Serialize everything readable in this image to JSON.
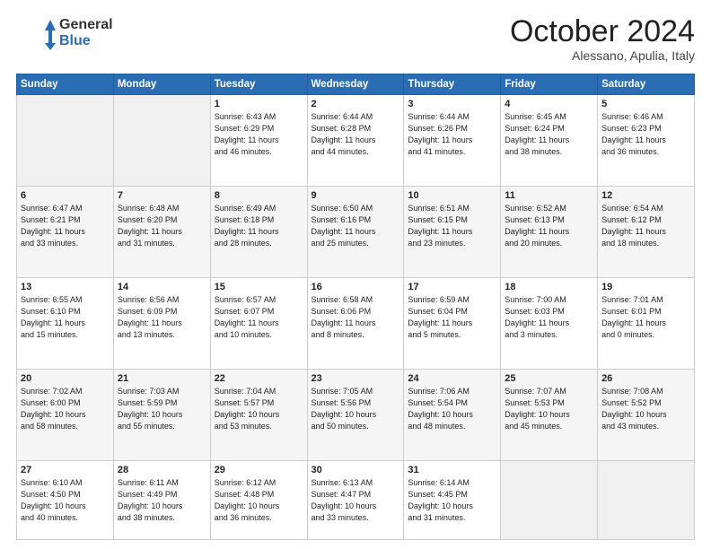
{
  "header": {
    "logo_line1": "General",
    "logo_line2": "Blue",
    "month": "October 2024",
    "location": "Alessano, Apulia, Italy"
  },
  "days_of_week": [
    "Sunday",
    "Monday",
    "Tuesday",
    "Wednesday",
    "Thursday",
    "Friday",
    "Saturday"
  ],
  "weeks": [
    [
      {
        "day": "",
        "empty": true
      },
      {
        "day": "",
        "empty": true
      },
      {
        "day": "1",
        "sunrise": "6:43 AM",
        "sunset": "6:29 PM",
        "daylight": "11 hours and 46 minutes."
      },
      {
        "day": "2",
        "sunrise": "6:44 AM",
        "sunset": "6:28 PM",
        "daylight": "11 hours and 44 minutes."
      },
      {
        "day": "3",
        "sunrise": "6:44 AM",
        "sunset": "6:26 PM",
        "daylight": "11 hours and 41 minutes."
      },
      {
        "day": "4",
        "sunrise": "6:45 AM",
        "sunset": "6:24 PM",
        "daylight": "11 hours and 38 minutes."
      },
      {
        "day": "5",
        "sunrise": "6:46 AM",
        "sunset": "6:23 PM",
        "daylight": "11 hours and 36 minutes."
      }
    ],
    [
      {
        "day": "6",
        "sunrise": "6:47 AM",
        "sunset": "6:21 PM",
        "daylight": "11 hours and 33 minutes."
      },
      {
        "day": "7",
        "sunrise": "6:48 AM",
        "sunset": "6:20 PM",
        "daylight": "11 hours and 31 minutes."
      },
      {
        "day": "8",
        "sunrise": "6:49 AM",
        "sunset": "6:18 PM",
        "daylight": "11 hours and 28 minutes."
      },
      {
        "day": "9",
        "sunrise": "6:50 AM",
        "sunset": "6:16 PM",
        "daylight": "11 hours and 25 minutes."
      },
      {
        "day": "10",
        "sunrise": "6:51 AM",
        "sunset": "6:15 PM",
        "daylight": "11 hours and 23 minutes."
      },
      {
        "day": "11",
        "sunrise": "6:52 AM",
        "sunset": "6:13 PM",
        "daylight": "11 hours and 20 minutes."
      },
      {
        "day": "12",
        "sunrise": "6:54 AM",
        "sunset": "6:12 PM",
        "daylight": "11 hours and 18 minutes."
      }
    ],
    [
      {
        "day": "13",
        "sunrise": "6:55 AM",
        "sunset": "6:10 PM",
        "daylight": "11 hours and 15 minutes."
      },
      {
        "day": "14",
        "sunrise": "6:56 AM",
        "sunset": "6:09 PM",
        "daylight": "11 hours and 13 minutes."
      },
      {
        "day": "15",
        "sunrise": "6:57 AM",
        "sunset": "6:07 PM",
        "daylight": "11 hours and 10 minutes."
      },
      {
        "day": "16",
        "sunrise": "6:58 AM",
        "sunset": "6:06 PM",
        "daylight": "11 hours and 8 minutes."
      },
      {
        "day": "17",
        "sunrise": "6:59 AM",
        "sunset": "6:04 PM",
        "daylight": "11 hours and 5 minutes."
      },
      {
        "day": "18",
        "sunrise": "7:00 AM",
        "sunset": "6:03 PM",
        "daylight": "11 hours and 3 minutes."
      },
      {
        "day": "19",
        "sunrise": "7:01 AM",
        "sunset": "6:01 PM",
        "daylight": "11 hours and 0 minutes."
      }
    ],
    [
      {
        "day": "20",
        "sunrise": "7:02 AM",
        "sunset": "6:00 PM",
        "daylight": "10 hours and 58 minutes."
      },
      {
        "day": "21",
        "sunrise": "7:03 AM",
        "sunset": "5:59 PM",
        "daylight": "10 hours and 55 minutes."
      },
      {
        "day": "22",
        "sunrise": "7:04 AM",
        "sunset": "5:57 PM",
        "daylight": "10 hours and 53 minutes."
      },
      {
        "day": "23",
        "sunrise": "7:05 AM",
        "sunset": "5:56 PM",
        "daylight": "10 hours and 50 minutes."
      },
      {
        "day": "24",
        "sunrise": "7:06 AM",
        "sunset": "5:54 PM",
        "daylight": "10 hours and 48 minutes."
      },
      {
        "day": "25",
        "sunrise": "7:07 AM",
        "sunset": "5:53 PM",
        "daylight": "10 hours and 45 minutes."
      },
      {
        "day": "26",
        "sunrise": "7:08 AM",
        "sunset": "5:52 PM",
        "daylight": "10 hours and 43 minutes."
      }
    ],
    [
      {
        "day": "27",
        "sunrise": "6:10 AM",
        "sunset": "4:50 PM",
        "daylight": "10 hours and 40 minutes."
      },
      {
        "day": "28",
        "sunrise": "6:11 AM",
        "sunset": "4:49 PM",
        "daylight": "10 hours and 38 minutes."
      },
      {
        "day": "29",
        "sunrise": "6:12 AM",
        "sunset": "4:48 PM",
        "daylight": "10 hours and 36 minutes."
      },
      {
        "day": "30",
        "sunrise": "6:13 AM",
        "sunset": "4:47 PM",
        "daylight": "10 hours and 33 minutes."
      },
      {
        "day": "31",
        "sunrise": "6:14 AM",
        "sunset": "4:45 PM",
        "daylight": "10 hours and 31 minutes."
      },
      {
        "day": "",
        "empty": true
      },
      {
        "day": "",
        "empty": true
      }
    ]
  ]
}
